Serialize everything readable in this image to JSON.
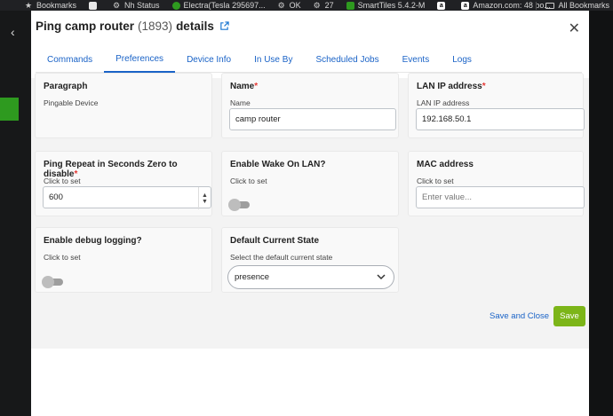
{
  "bookmarks_bar": {
    "items": [
      {
        "label": "Bookmarks",
        "icon": "star-icon"
      },
      {
        "label": "",
        "icon": "hubitat-icon"
      },
      {
        "label": "Nh Status",
        "icon": "gear-icon"
      },
      {
        "label": "Electra(Tesla 295697...",
        "icon": "electra-icon"
      },
      {
        "label": "OK",
        "icon": "gear-icon"
      },
      {
        "label": "27",
        "icon": "gear-icon"
      },
      {
        "label": "SmartTiles 5.4.2-M",
        "icon": "smarttiles-icon"
      },
      {
        "label": "",
        "icon": "amazon-icon"
      },
      {
        "label": "Amazon.com: 48 bo...",
        "icon": "amazon-icon"
      }
    ],
    "all_bookmarks": "All Bookmarks"
  },
  "modal": {
    "title": "Ping camp router",
    "device_id": "(1893)",
    "title_suffix": "details",
    "tabs": [
      {
        "label": "Commands",
        "active": false
      },
      {
        "label": "Preferences",
        "active": true
      },
      {
        "label": "Device Info",
        "active": false
      },
      {
        "label": "In Use By",
        "active": false
      },
      {
        "label": "Scheduled Jobs",
        "active": false
      },
      {
        "label": "Events",
        "active": false
      },
      {
        "label": "Logs",
        "active": false
      }
    ]
  },
  "preferences": {
    "paragraph": {
      "label": "Paragraph",
      "text": "Pingable Device"
    },
    "name": {
      "label": "Name",
      "required": "*",
      "sub": "Name",
      "value": "camp router"
    },
    "lan_ip": {
      "label": "LAN IP address",
      "required": "*",
      "sub": "LAN IP address",
      "value": "192.168.50.1"
    },
    "ping_repeat": {
      "label": "Ping Repeat in Seconds Zero to disable",
      "required": "*",
      "sub": "Click to set",
      "value": "600"
    },
    "wake_on_lan": {
      "label": "Enable Wake On LAN?",
      "sub": "Click to set",
      "enabled": false
    },
    "mac": {
      "label": "MAC address",
      "sub": "Click to set",
      "placeholder": "Enter value..."
    },
    "debug": {
      "label": "Enable debug logging?",
      "sub": "Click to set",
      "enabled": false
    },
    "default_state": {
      "label": "Default Current State",
      "sub": "Select the default current state",
      "value": "presence"
    }
  },
  "actions": {
    "save_and_close": "Save and Close",
    "save": "Save"
  },
  "colors": {
    "accent": "#1a63c7",
    "save_green": "#7cb518",
    "required_red": "#e53935"
  }
}
